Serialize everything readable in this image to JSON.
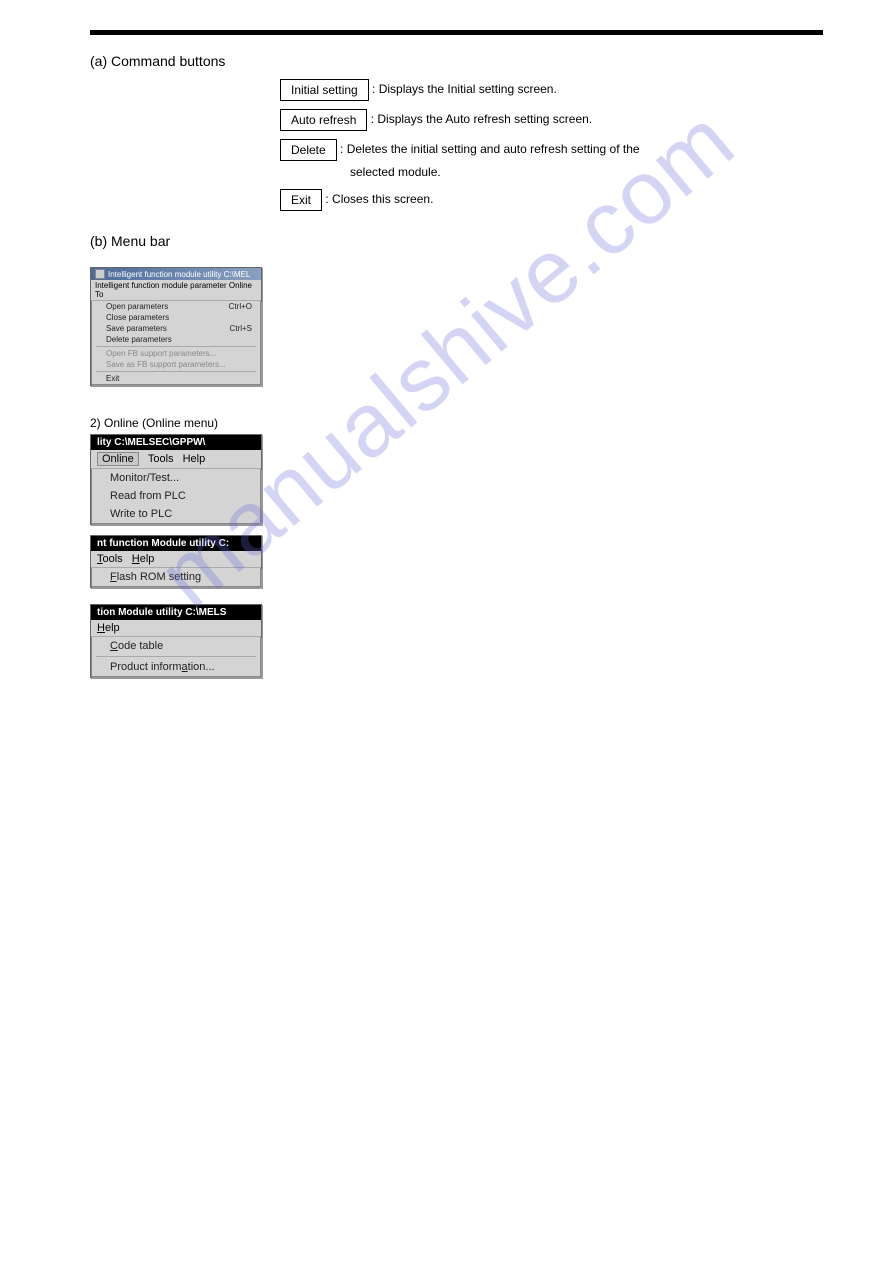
{
  "watermark": "manualshive.com",
  "section_a": {
    "heading": "(a) Command buttons",
    "lines": {
      "l1_btn": "Initial setting",
      "l1_txt": "  : Displays the Initial setting screen.",
      "l2_btn": "Auto refresh",
      "l2_txt": "  : Displays the Auto refresh setting screen.",
      "l3_btn": "Delete",
      "l3_txt": "  : Deletes the initial setting and auto refresh setting of the",
      "l3_cont": "    selected module.",
      "l4_btn": "Exit",
      "l4_txt": "  : Closes this screen."
    }
  },
  "section_b": {
    "heading": "(b) Menu bar"
  },
  "ss1": {
    "title": "Intelligent function module utility C:\\MEL",
    "menubar": "Intelligent function module parameter   Online   To",
    "items": [
      {
        "label": "Open parameters",
        "accel": "Ctrl+O"
      },
      {
        "label": "Close parameters",
        "accel": ""
      },
      {
        "label": "Save parameters",
        "accel": "Ctrl+S"
      },
      {
        "label": "Delete parameters",
        "accel": ""
      }
    ],
    "grey_items": [
      "Open FB support parameters...",
      "Save as FB support parameters..."
    ],
    "exit": "Exit"
  },
  "online_label": "2) Online (Online menu)",
  "ss2": {
    "title": "lity C:\\MELSEC\\GPPW\\",
    "menubar_items": [
      "Online",
      "Tools",
      "Help"
    ],
    "items": [
      "Monitor/Test...",
      "Read from PLC",
      "Write to PLC"
    ]
  },
  "ss3": {
    "title": "nt function Module utility C:",
    "menubar_items": [
      "Tools",
      "Help"
    ],
    "items": [
      "Flash ROM setting"
    ]
  },
  "ss4": {
    "title": "tion Module utility C:\\MELS",
    "menubar_items": [
      "Help"
    ],
    "items": [
      "Code table",
      "Product information..."
    ]
  }
}
